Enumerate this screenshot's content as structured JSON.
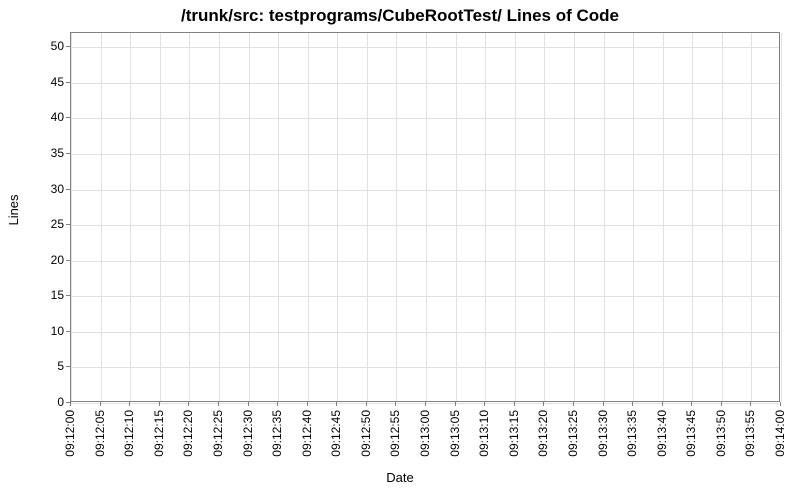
{
  "chart_data": {
    "type": "line",
    "title": "/trunk/src: testprograms/CubeRootTest/ Lines of Code",
    "xlabel": "Date",
    "ylabel": "Lines",
    "ylim": [
      0,
      52
    ],
    "y_ticks": [
      0,
      5,
      10,
      15,
      20,
      25,
      30,
      35,
      40,
      45,
      50
    ],
    "x_ticks": [
      "09:12:00",
      "09:12:05",
      "09:12:10",
      "09:12:15",
      "09:12:20",
      "09:12:25",
      "09:12:30",
      "09:12:35",
      "09:12:40",
      "09:12:45",
      "09:12:50",
      "09:12:55",
      "09:13:00",
      "09:13:05",
      "09:13:10",
      "09:13:15",
      "09:13:20",
      "09:13:25",
      "09:13:30",
      "09:13:35",
      "09:13:40",
      "09:13:45",
      "09:13:50",
      "09:13:55",
      "09:14:00"
    ],
    "series": []
  }
}
